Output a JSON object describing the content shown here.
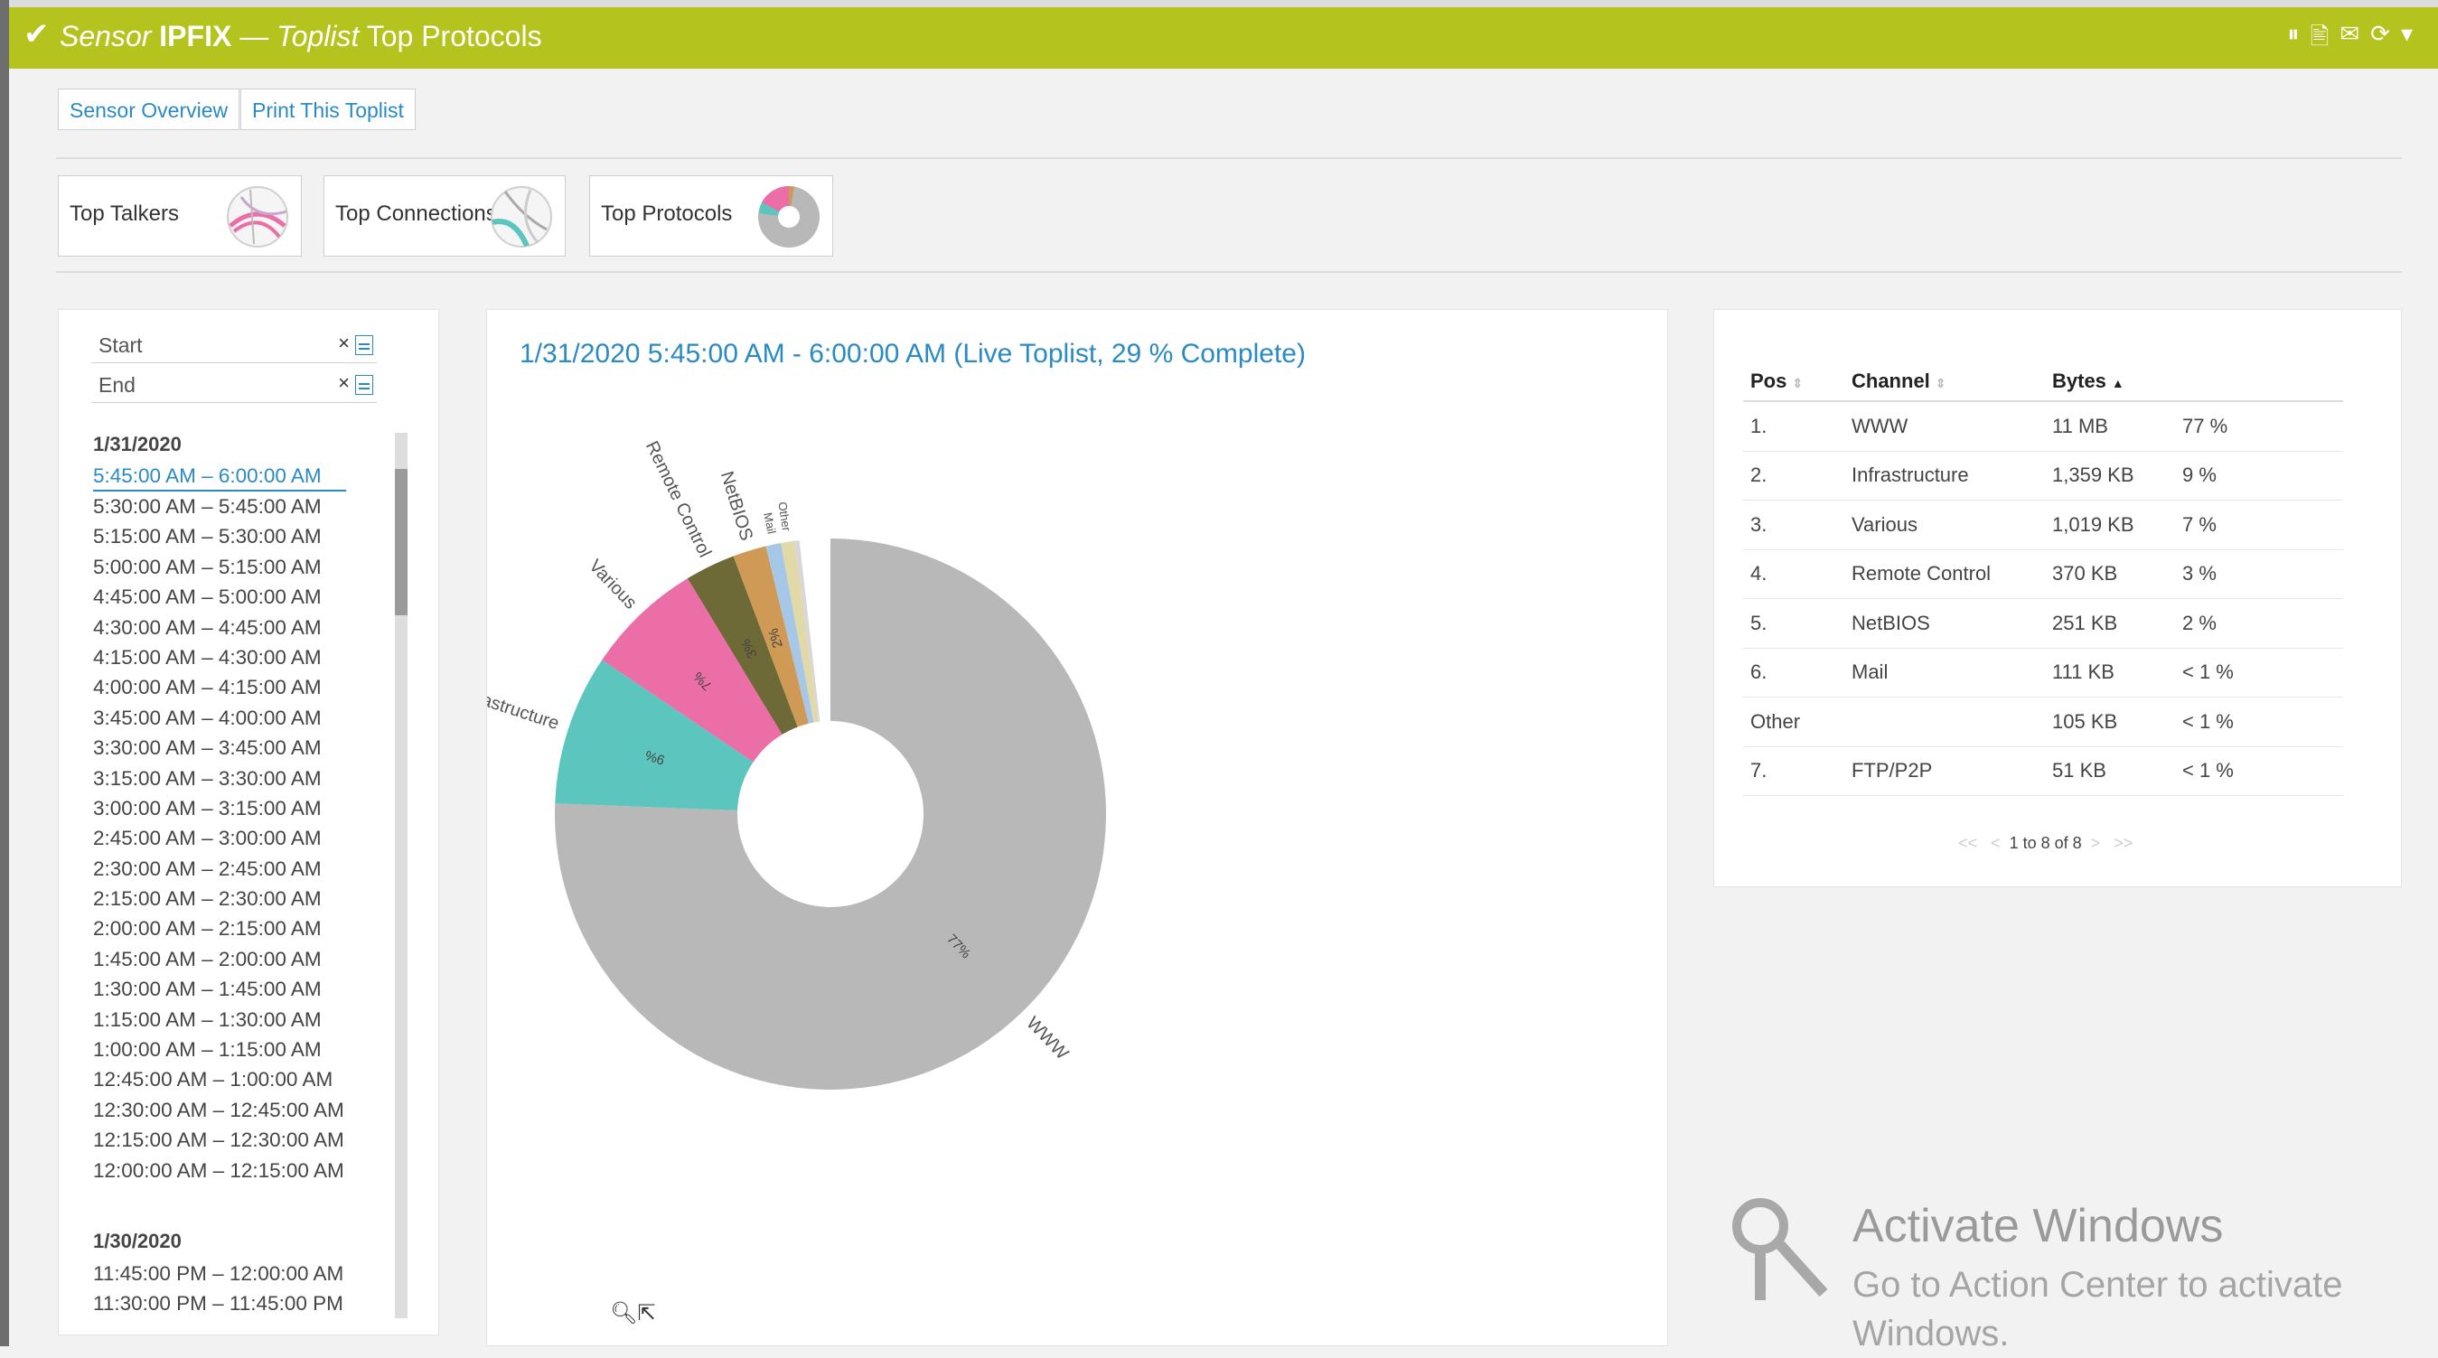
{
  "header": {
    "sensor_label": "Sensor",
    "sensor_name": "IPFIX",
    "dash": "—",
    "toplist_label": "Toplist",
    "toplist_name": "Top Protocols",
    "tools": [
      "⏸",
      "🖹",
      "✉",
      "⟳",
      "▾"
    ]
  },
  "toolbar": {
    "sensor_overview": "Sensor Overview",
    "print": "Print This Toplist"
  },
  "tabs": [
    {
      "label": "Top Talkers"
    },
    {
      "label": "Top Connections"
    },
    {
      "label": "Top Protocols"
    }
  ],
  "sidebar": {
    "start_placeholder": "Start",
    "end_placeholder": "End",
    "clear": "×",
    "date1": "1/31/2020",
    "times1": [
      "5:45:00 AM – 6:00:00 AM",
      "5:30:00 AM – 5:45:00 AM",
      "5:15:00 AM – 5:30:00 AM",
      "5:00:00 AM – 5:15:00 AM",
      "4:45:00 AM – 5:00:00 AM",
      "4:30:00 AM – 4:45:00 AM",
      "4:15:00 AM – 4:30:00 AM",
      "4:00:00 AM – 4:15:00 AM",
      "3:45:00 AM – 4:00:00 AM",
      "3:30:00 AM – 3:45:00 AM",
      "3:15:00 AM – 3:30:00 AM",
      "3:00:00 AM – 3:15:00 AM",
      "2:45:00 AM – 3:00:00 AM",
      "2:30:00 AM – 2:45:00 AM",
      "2:15:00 AM – 2:30:00 AM",
      "2:00:00 AM – 2:15:00 AM",
      "1:45:00 AM – 2:00:00 AM",
      "1:30:00 AM – 1:45:00 AM",
      "1:15:00 AM – 1:30:00 AM",
      "1:00:00 AM – 1:15:00 AM",
      "12:45:00 AM – 1:00:00 AM",
      "12:30:00 AM – 12:45:00 AM",
      "12:15:00 AM – 12:30:00 AM",
      "12:00:00 AM – 12:15:00 AM"
    ],
    "date2": "1/30/2020",
    "times2": [
      "11:45:00 PM – 12:00:00 AM",
      "11:30:00 PM – 11:45:00 PM"
    ]
  },
  "chart_panel": {
    "title": "1/31/2020 5:45:00 AM - 6:00:00 AM (Live Toplist, 29 % Complete)",
    "zoom_icons": "🔍︎⇱"
  },
  "chart_data": {
    "type": "pie",
    "donut": true,
    "series": [
      {
        "label": "WWW",
        "value": 77,
        "pct_label": "77%",
        "color": "#b8b8b8"
      },
      {
        "label": "Infrastructure",
        "value": 9,
        "pct_label": "9%",
        "color": "#5bc5be"
      },
      {
        "label": "Various",
        "value": 7,
        "pct_label": "7%",
        "color": "#ec6ea7"
      },
      {
        "label": "Remote Control",
        "value": 3,
        "pct_label": "3%",
        "color": "#6d6a38"
      },
      {
        "label": "NetBIOS",
        "value": 2,
        "pct_label": "2%",
        "color": "#cf9a55"
      },
      {
        "label": "Mail",
        "value": 0.9,
        "pct_label": "",
        "color": "#a7c7e8"
      },
      {
        "label": "Other",
        "value": 0.8,
        "pct_label": "",
        "color": "#e1d9a7"
      },
      {
        "label": "FTP/P2P",
        "value": 0.3,
        "pct_label": "",
        "color": "#d7d7d7"
      }
    ]
  },
  "table": {
    "headers": {
      "pos": "Pos",
      "channel": "Channel",
      "bytes": "Bytes"
    },
    "rows": [
      {
        "pos": "1.",
        "channel": "WWW",
        "bytes": "11 MB",
        "pct": "77 %"
      },
      {
        "pos": "2.",
        "channel": "Infrastructure",
        "bytes": "1,359 KB",
        "pct": "9 %"
      },
      {
        "pos": "3.",
        "channel": "Various",
        "bytes": "1,019 KB",
        "pct": "7 %"
      },
      {
        "pos": "4.",
        "channel": "Remote Control",
        "bytes": "370 KB",
        "pct": "3 %"
      },
      {
        "pos": "5.",
        "channel": "NetBIOS",
        "bytes": "251 KB",
        "pct": "2 %"
      },
      {
        "pos": "6.",
        "channel": "Mail",
        "bytes": "111 KB",
        "pct": "< 1 %"
      },
      {
        "pos": "Other",
        "channel": "",
        "bytes": "105 KB",
        "pct": "< 1 %"
      },
      {
        "pos": "7.",
        "channel": "FTP/P2P",
        "bytes": "51 KB",
        "pct": "< 1 %"
      }
    ],
    "pager": {
      "first": "<<",
      "prev": "<",
      "text": "1 to 8 of 8",
      "next": ">",
      "last": ">>"
    }
  },
  "watermark": {
    "heading": "Activate Windows",
    "subtext": "Go to Action Center to activate Windows."
  }
}
